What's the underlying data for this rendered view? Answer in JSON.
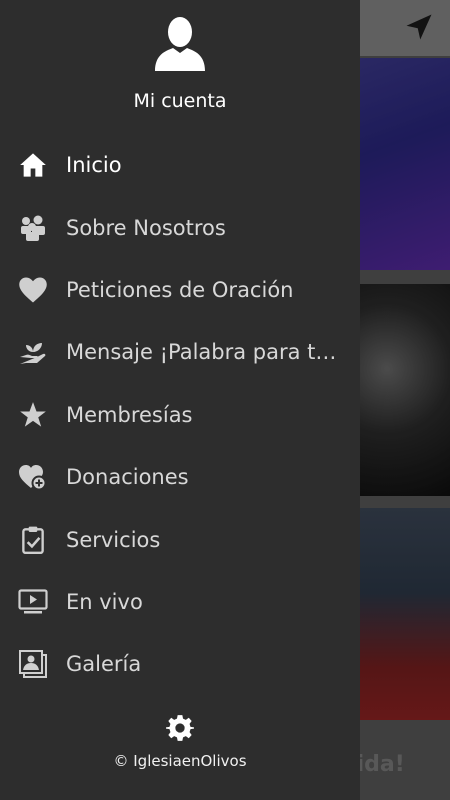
{
  "background": {
    "partial_text": "Vida!"
  },
  "drawer": {
    "account_label": "Mi cuenta",
    "items": [
      {
        "label": "Inicio",
        "icon": "home-icon"
      },
      {
        "label": "Sobre Nosotros",
        "icon": "people-icon"
      },
      {
        "label": "Peticiones de Oración",
        "icon": "heart-icon"
      },
      {
        "label": "Mensaje ¡Palabra para tu …",
        "icon": "hand-plant-icon"
      },
      {
        "label": "Membresías",
        "icon": "star-icon"
      },
      {
        "label": "Donaciones",
        "icon": "heart-plus-icon"
      },
      {
        "label": "Servicios",
        "icon": "clipboard-check-icon"
      },
      {
        "label": "En vivo",
        "icon": "tv-play-icon"
      },
      {
        "label": "Galería",
        "icon": "photo-gallery-icon"
      }
    ],
    "footer": "© IglesiaenOlivos"
  },
  "colors": {
    "drawer_bg": "#2d2d2d",
    "text": "#ffffff"
  }
}
